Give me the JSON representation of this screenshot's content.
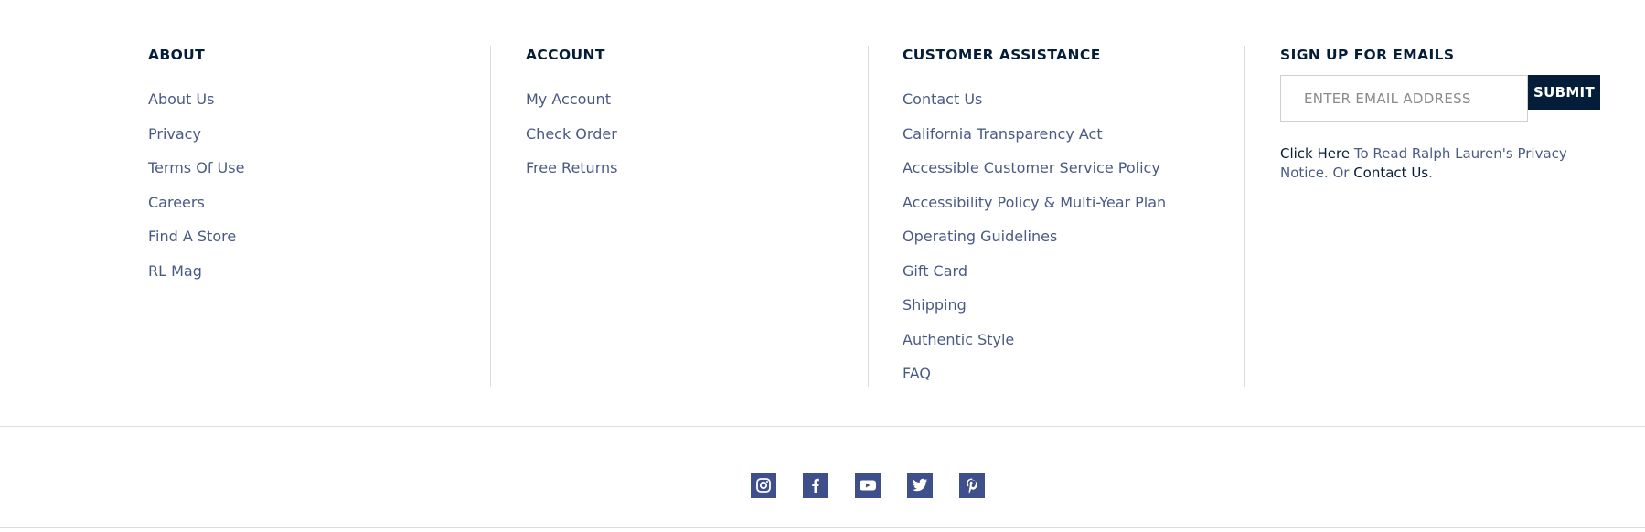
{
  "about": {
    "heading": "ABOUT",
    "links": [
      "About Us",
      "Privacy",
      "Terms Of Use",
      "Careers",
      "Find A Store",
      "RL Mag"
    ]
  },
  "account": {
    "heading": "ACCOUNT",
    "links": [
      "My Account",
      "Check Order",
      "Free Returns"
    ]
  },
  "customer_assistance": {
    "heading": "CUSTOMER ASSISTANCE",
    "links": [
      "Contact Us",
      "California Transparency Act",
      "Accessible Customer Service Policy",
      "Accessibility Policy & Multi-Year Plan",
      "Operating Guidelines",
      "Gift Card",
      "Shipping",
      "Authentic Style",
      "FAQ"
    ]
  },
  "signup": {
    "heading": "SIGN UP FOR EMAILS",
    "email_placeholder": "ENTER EMAIL ADDRESS",
    "submit_label": "SUBMIT",
    "privacy_click_here": "Click Here",
    "privacy_text": " To Read Ralph Lauren's Privacy Notice. Or ",
    "privacy_contact": "Contact Us",
    "privacy_end": "."
  },
  "social": {
    "icons": [
      "instagram-icon",
      "facebook-icon",
      "youtube-icon",
      "twitter-icon",
      "pinterest-icon"
    ]
  },
  "colors": {
    "navy": "#041E3A",
    "link": "#4a5a85",
    "social_bg": "#3f4f8c",
    "rule": "#dcdcdc"
  }
}
